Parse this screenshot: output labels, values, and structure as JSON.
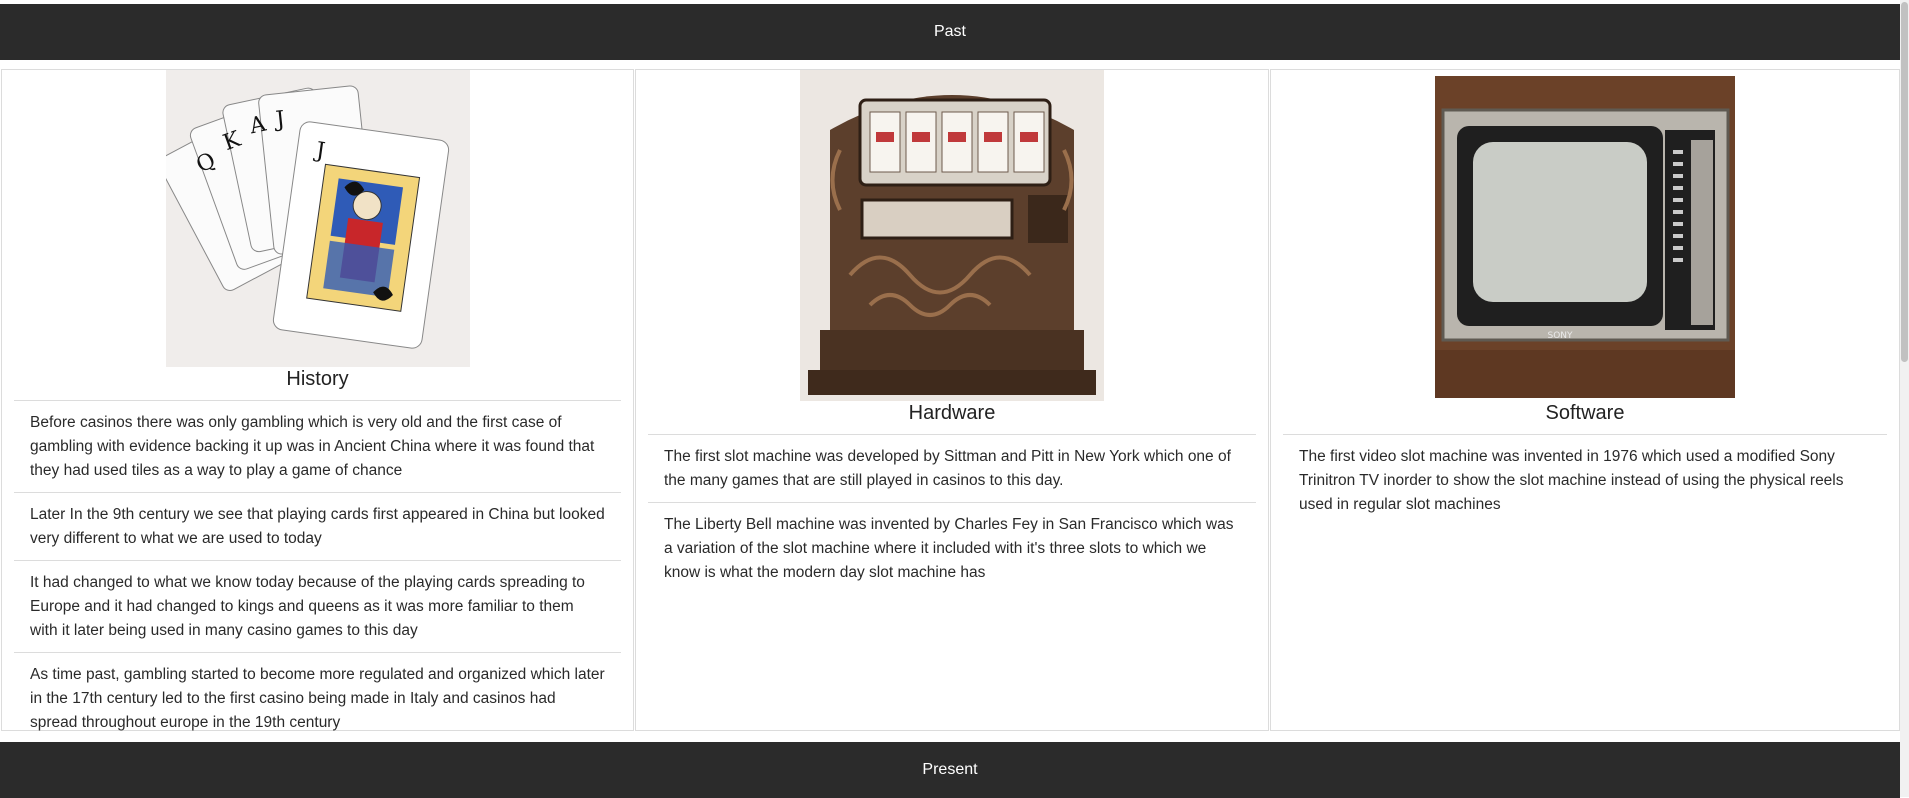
{
  "sections": {
    "past_label": "Past",
    "present_label": "Present"
  },
  "cards": [
    {
      "title": "History",
      "items": [
        "Before casinos there was only gambling which is very old and the first case of gambling with evidence backing it up was in Ancient China where it was found that they had used tiles as a way to play a game of chance",
        "Later In the 9th century we see that playing cards first appeared in China but looked very different to what we are used to today",
        "It had changed to what we know today because of the playing cards spreading to Europe and it had changed to kings and queens as it was more familiar to them with it later being used in many casino games to this day",
        "As time past, gambling started to become more regulated and organized which later in the 17th century led to the first casino being made in Italy and casinos had spread throughout europe in the 19th century"
      ]
    },
    {
      "title": "Hardware",
      "items": [
        "The first slot machine was developed by Sittman and Pitt in New York which one of the many games that are still played in casinos to this day.",
        "The Liberty Bell machine was invented by Charles Fey in San Francisco which was a variation of the slot machine where it included with it's three slots to which we know is what the modern day slot machine has"
      ]
    },
    {
      "title": "Software",
      "items": [
        "The first video slot machine was invented in 1976 which used a modified Sony Trinitron TV inorder to show the slot machine instead of using the physical reels used in regular slot machines"
      ]
    }
  ],
  "images": {
    "history": "playing-cards-royal-flush",
    "hardware": "antique-slot-machine",
    "software": "sony-trinitron-tv",
    "tv_brand_text": "SONY"
  }
}
